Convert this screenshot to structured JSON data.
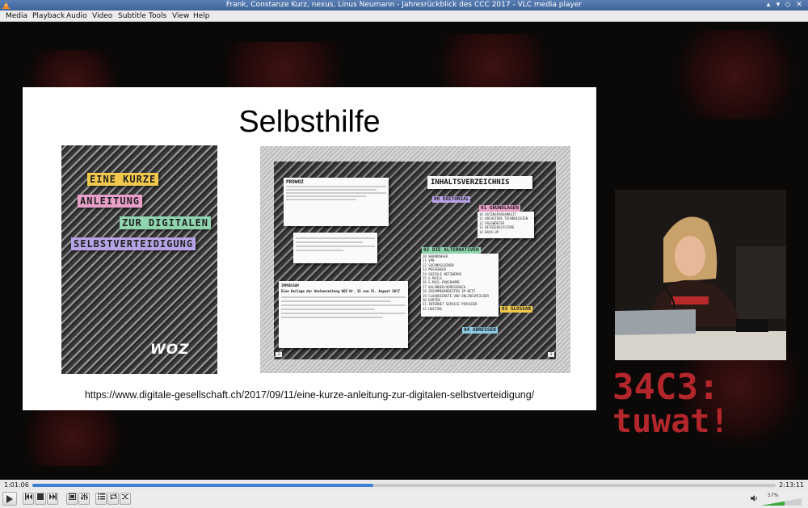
{
  "window": {
    "title": "Frank, Constanze Kurz, nexus, Linus Neumann - Jahresrückblick des CCC 2017 - VLC media player",
    "controls": [
      "▴",
      "▾",
      "◇",
      "✕"
    ]
  },
  "menu": [
    "Media",
    "Playback",
    "Audio",
    "Video",
    "Subtitle",
    "Tools",
    "View",
    "Help"
  ],
  "slide": {
    "title": "Selbsthilfe",
    "cover_lines": [
      "EINE KURZE",
      "ANLEITUNG",
      "ZUR DIGITALEN",
      "SELBSTVERTEIDIGUNG"
    ],
    "cover_colors": [
      "#f2c94c",
      "#e9a0c8",
      "#8fd6b0",
      "#b7a4e6"
    ],
    "cover_logo": "WOZ",
    "spread": {
      "toc_title": "INHALTSVERZEICHNIS",
      "sections": [
        {
          "label": "00 EDITORIAL",
          "color": "#b7a4e6"
        },
        {
          "label": "01 GRUNDLAGEN",
          "color": "#e9a0c8"
        },
        {
          "label": "02 DIE ALTERNATIVEN",
          "color": "#8fd6b0"
        },
        {
          "label": "03 GLOSSAR",
          "color": "#f2c94c"
        },
        {
          "label": "04 ADRESSEN",
          "color": "#8ec9e6"
        }
      ],
      "grundlagen_items": [
        "10 DATENSPARSAMKEIT",
        "11 HOCHSTENS TECHNOLOGIEN",
        "12 PASSWÖRTER",
        "13 BETRIEBSSYSTEME",
        "14 BACK-UP"
      ],
      "alternativen_items": [
        "20 WEBBROWSER",
        "21 VPN",
        "22 SUCHMASCHINEN",
        "23 MESSENGER",
        "24 SOZIALE NETZWERKE",
        "25 E-MAILS",
        "26 E-MAIL-PROGRAMME",
        "27 KALENDER/ADRESSBUCH",
        "28 ZUSAMMENARBEITEN IM NETZ",
        "29 CLOUDDIENSTE UND ONLINESPEICHER",
        "30 KARTEN",
        "31 INTERNET SERVICE PROVIDER",
        "32 HOSTING"
      ],
      "pro_woz": "PROWOZ",
      "impressum": "IMPRESSUM",
      "impressum_sub": "Eine Beilage der Wochenzeitung WOZ Nr. 35 vom 31. August 2017",
      "page_left": "2",
      "page_right": "3"
    },
    "url": "https://www.digitale-gesellschaft.ch/2017/09/11/eine-kurze-anleitung-zur-digitalen-selbstverteidigung/"
  },
  "overlay_logo": [
    "34C3:",
    "tuwat!"
  ],
  "player": {
    "elapsed": "1:01:06",
    "total": "2:13:11",
    "progress": 0.459,
    "volume_label": "57%",
    "volume": 0.57,
    "buttons": [
      "play-button",
      "previous-button",
      "stop-button",
      "next-button",
      "fullscreen-button",
      "extended-settings-button",
      "playlist-button",
      "loop-button",
      "random-button"
    ]
  }
}
